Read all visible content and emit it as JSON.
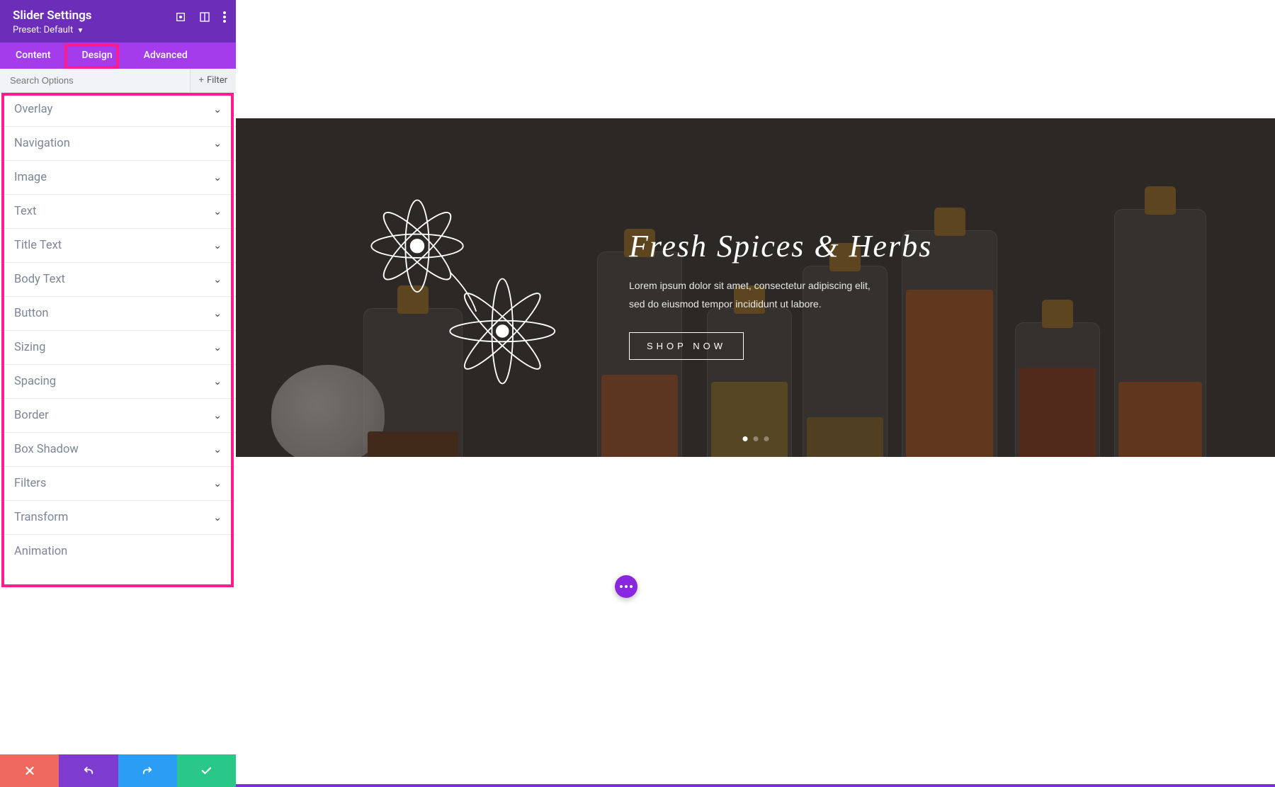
{
  "sidebar": {
    "title": "Slider Settings",
    "preset_label": "Preset:",
    "preset_value": "Default",
    "tabs": [
      "Content",
      "Design",
      "Advanced"
    ],
    "active_tab_index": 1,
    "search_placeholder": "Search Options",
    "filter_label": "Filter",
    "sections": [
      "Overlay",
      "Navigation",
      "Image",
      "Text",
      "Title Text",
      "Body Text",
      "Button",
      "Sizing",
      "Spacing",
      "Border",
      "Box Shadow",
      "Filters",
      "Transform",
      "Animation"
    ]
  },
  "hero": {
    "title": "Fresh Spices & Herbs",
    "body_line1": "Lorem ipsum dolor sit amet, consectetur adipiscing elit,",
    "body_line2": "sed do eiusmod tempor incididunt ut labore.",
    "button_label": "SHOP NOW",
    "dot_count": 3,
    "active_dot": 0
  },
  "highlight": {
    "tab": "Design",
    "list": true
  },
  "colors": {
    "header_purple": "#6c2eb9",
    "tabs_purple": "#a53cec",
    "highlight_pink": "#ff1d8e",
    "fab_purple": "#8927e0",
    "close_red": "#ef6a5e",
    "undo_purple": "#7e3bd0",
    "redo_blue": "#2b9ef3",
    "save_green": "#29c789"
  }
}
